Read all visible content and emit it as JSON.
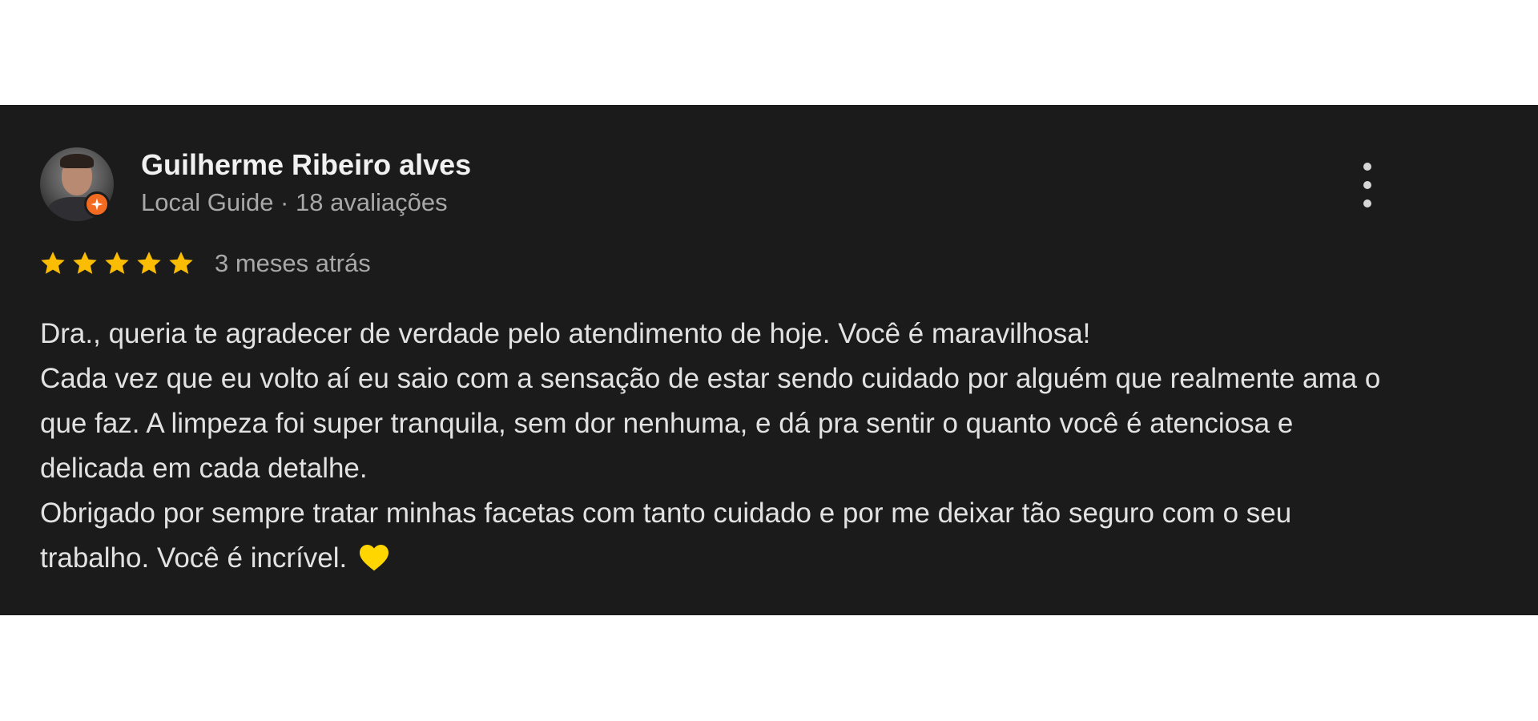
{
  "review": {
    "author": {
      "name": "Guilherme Ribeiro alves",
      "meta": "Local Guide · 18 avaliações",
      "avatar_icon": "profile-photo",
      "badge_icon": "local-guide-badge-icon",
      "badge_color": "#f26b21"
    },
    "rating": {
      "stars": 5,
      "max": 5,
      "star_color": "#fbbc04"
    },
    "time": "3 meses atrás",
    "body": {
      "line1": "Dra., queria te agradecer de verdade pelo atendimento de hoje. Você é maravilhosa!",
      "paragraph2": "Cada vez que eu volto aí eu saio com a sensação de estar sendo cuidado por alguém que realmente ama o que faz. A limpeza foi super tranquila, sem dor nenhuma, e dá pra sentir o quanto você é atenciosa e delicada em cada detalhe.",
      "paragraph3": "Obrigado por sempre tratar minhas facetas com tanto cuidado e por me deixar tão seguro com o seu trabalho. Você é incrível.",
      "emoji_icon": "yellow-heart-icon",
      "emoji_color": "#ffd600"
    },
    "menu_icon": "more-vert-icon"
  },
  "colors": {
    "card_background": "#1b1b1b",
    "page_background": "#ffffff",
    "primary_text": "#f1f1f1",
    "secondary_text": "#a8a8a8",
    "body_text": "#e2e2e2"
  }
}
